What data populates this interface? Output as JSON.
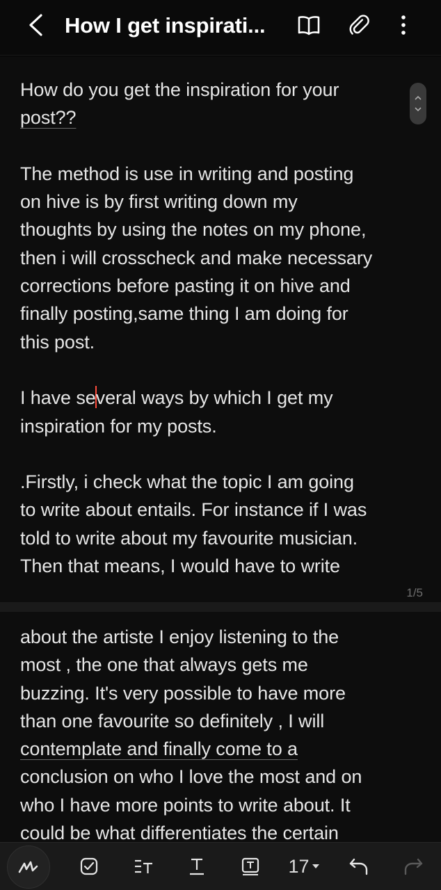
{
  "header": {
    "title": "How I get inspirati...",
    "icons": [
      "back-icon",
      "book-icon",
      "paperclip-icon",
      "more-vertical-icon"
    ]
  },
  "page1": {
    "lines": [
      [
        "How do you get the inspiration for your"
      ],
      [
        "post??"
      ],
      [
        ""
      ],
      [
        "The method is use in writing and posting"
      ],
      [
        "on hive is by first writing down my"
      ],
      [
        "thoughts by using the notes on my phone,"
      ],
      [
        "then i will crosscheck and make necessary"
      ],
      [
        "corrections before pasting it on hive and"
      ],
      [
        "finally posting,same thing I am doing for"
      ],
      [
        "this post."
      ],
      [
        ""
      ],
      [
        " I have several ways by which I get my"
      ],
      [
        "inspiration for my posts."
      ],
      [
        ""
      ],
      [
        ".Firstly,  i check what the topic I am going"
      ],
      [
        "to write about entails. For instance if I was"
      ],
      [
        "told to write about my favourite musician."
      ],
      [
        "Then that means, I would have to write"
      ]
    ],
    "page_indicator": "1/5"
  },
  "page2": {
    "lines": [
      "about the artiste I enjoy listening to the",
      "most , the one that always gets me",
      "buzzing. It's very possible to have more",
      "than one favourite so definitely , I will",
      "contemplate and finally come to a",
      "conclusion on who I love the most and on",
      "who I have more points to write about. It",
      "could be what differentiates the certain"
    ]
  },
  "toolbar": {
    "font_size": "17",
    "icons": [
      "pen-icon",
      "checkbox-icon",
      "text-style-icon",
      "text-underline-icon",
      "text-box-icon",
      "undo-icon",
      "redo-icon"
    ]
  },
  "colors": {
    "background": "#000000",
    "text": "#e6e6e6",
    "cursor": "#ff4d3d",
    "toolbar": "#1a1a1a"
  }
}
